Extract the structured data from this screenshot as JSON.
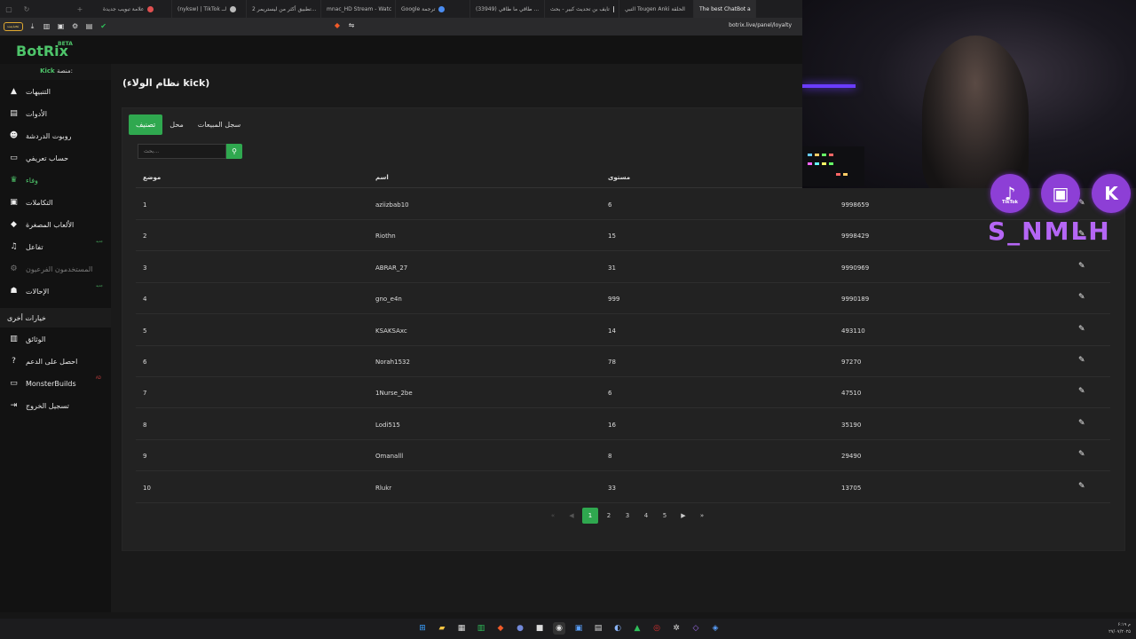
{
  "browser": {
    "tabs": [
      {
        "label": "علامة تبويب جديدة",
        "color": "#e05050"
      },
      {
        "label": "(nyksw) | TikTok لــ",
        "color": "#bbbbbb"
      },
      {
        "label": "تطبيق أكثر من ليستريمر 2...",
        "color": "#888888"
      },
      {
        "label": "mnac_HD Stream - Watc",
        "color": "#2fe06a"
      },
      {
        "label": "Google ترجمة",
        "color": "#4a8cf0"
      },
      {
        "label": "(33949) طاقي ما طاقي ...",
        "color": "#e03030"
      },
      {
        "label": "تايف بن تحديث كبير - بحث",
        "color": "#cccccc"
      },
      {
        "label": "التبي Tougen Anki الحلقة",
        "color": "#60b0f0"
      },
      {
        "label": "The best ChatBot a",
        "color": "#4ec46a"
      }
    ],
    "update_label": "تحديث",
    "url": "botrix.live/panel/loyalty"
  },
  "app": {
    "logo": "BotRix",
    "beta": "BETA",
    "platform_label": "منصة:",
    "platform_name": "Kick",
    "page_title": "(نظام الولاء kick)"
  },
  "sidebar": {
    "items": [
      {
        "label": "التنبيهات",
        "icon": "warning-icon"
      },
      {
        "label": "الأدوات",
        "icon": "tools-icon"
      },
      {
        "label": "روبوت الدردشة",
        "icon": "robot-icon"
      },
      {
        "label": "حساب تعريفي",
        "icon": "id-card-icon"
      },
      {
        "label": "وفاء",
        "icon": "trophy-icon"
      },
      {
        "label": "التكاملات",
        "icon": "integration-icon"
      },
      {
        "label": "الألعاب المصغرة",
        "icon": "games-icon"
      },
      {
        "label": "تفاعل",
        "icon": "music-icon",
        "badge": "جديد"
      },
      {
        "label": "المستخدمون الفرعيون",
        "icon": "users-gear-icon"
      },
      {
        "label": "الإحالات",
        "icon": "referrals-icon",
        "badge": "جديد"
      }
    ],
    "section_label": "خيارات أخرى",
    "other_items": [
      {
        "label": "الوثائق",
        "icon": "docs-icon"
      },
      {
        "label": "احصل على الدعم",
        "icon": "help-icon"
      },
      {
        "label": "MonsterBuilds",
        "icon": "monitor-icon",
        "badge": "AD"
      },
      {
        "label": "تسجيل الخروج",
        "icon": "logout-icon"
      }
    ]
  },
  "tabs": {
    "ranking": "تصنيف",
    "shop": "محل",
    "sales_log": "سجل المبيعات"
  },
  "search": {
    "placeholder": "بحث..."
  },
  "table": {
    "headers": [
      "موضع",
      "اسم",
      "مستوى",
      ""
    ],
    "rows": [
      {
        "pos": "1",
        "name": "aziizbab10",
        "level": "6",
        "points": "9998659"
      },
      {
        "pos": "2",
        "name": "Riothn",
        "level": "15",
        "points": "9998429"
      },
      {
        "pos": "3",
        "name": "ABRAR_27",
        "level": "31",
        "points": "9990969"
      },
      {
        "pos": "4",
        "name": "gno_e4n",
        "level": "999",
        "points": "9990189"
      },
      {
        "pos": "5",
        "name": "KSAKSAxc",
        "level": "14",
        "points": "493110"
      },
      {
        "pos": "6",
        "name": "Norah1532",
        "level": "78",
        "points": "97270"
      },
      {
        "pos": "7",
        "name": "1Nurse_2be",
        "level": "6",
        "points": "47510"
      },
      {
        "pos": "8",
        "name": "Lodi515",
        "level": "16",
        "points": "35190"
      },
      {
        "pos": "9",
        "name": "Omanalll",
        "level": "8",
        "points": "29490"
      },
      {
        "pos": "10",
        "name": "Rlukr",
        "level": "33",
        "points": "13705"
      }
    ]
  },
  "pagination": {
    "pages": [
      "1",
      "2",
      "3",
      "4",
      "5"
    ],
    "current": "1"
  },
  "overlay": {
    "handle": "S_NMLH",
    "socials": [
      {
        "label": "TikTok",
        "icon": "tiktok-icon"
      },
      {
        "label": "",
        "icon": "twitch-icon"
      },
      {
        "label": "",
        "icon": "kick-icon"
      }
    ]
  },
  "taskbar": {
    "time": "۶:۱۹ م",
    "date": "۲۷/۰۷/۲۰۲۵"
  }
}
